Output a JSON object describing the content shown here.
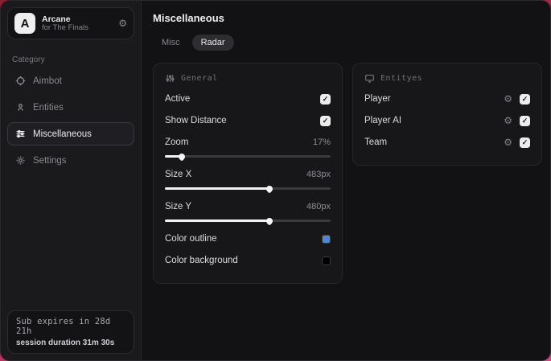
{
  "sidebar": {
    "brand": {
      "logo_letter": "A",
      "name": "Arcane",
      "subtitle": "for The Finals"
    },
    "category_label": "Category",
    "items": [
      {
        "label": "Aimbot"
      },
      {
        "label": "Entities"
      },
      {
        "label": "Miscellaneous"
      },
      {
        "label": "Settings"
      }
    ],
    "footer": {
      "line1": "Sub expires in 28d 21h",
      "line2": "session duration 31m 30s"
    }
  },
  "main": {
    "title": "Miscellaneous",
    "tabs": [
      {
        "label": "Misc"
      },
      {
        "label": "Radar"
      }
    ],
    "general": {
      "title": "General",
      "toggles": [
        {
          "label": "Active",
          "checked": true
        },
        {
          "label": "Show Distance",
          "checked": true
        }
      ],
      "sliders": [
        {
          "label": "Zoom",
          "value": "17%",
          "percent": 10
        },
        {
          "label": "Size X",
          "value": "483px",
          "percent": 63
        },
        {
          "label": "Size Y",
          "value": "480px",
          "percent": 63
        }
      ],
      "colors": [
        {
          "label": "Color outline",
          "swatch": "#4a8ad4"
        },
        {
          "label": "Color background",
          "swatch": "#000000"
        }
      ]
    },
    "entities": {
      "title": "Entityes",
      "rows": [
        {
          "label": "Player",
          "checked": true
        },
        {
          "label": "Player AI",
          "checked": true
        },
        {
          "label": "Team",
          "checked": true
        }
      ]
    }
  },
  "colors": {
    "accent_blue": "#4a8ad4",
    "desktop_red": "#8a1f31",
    "desktop_pink": "#d6437f"
  }
}
